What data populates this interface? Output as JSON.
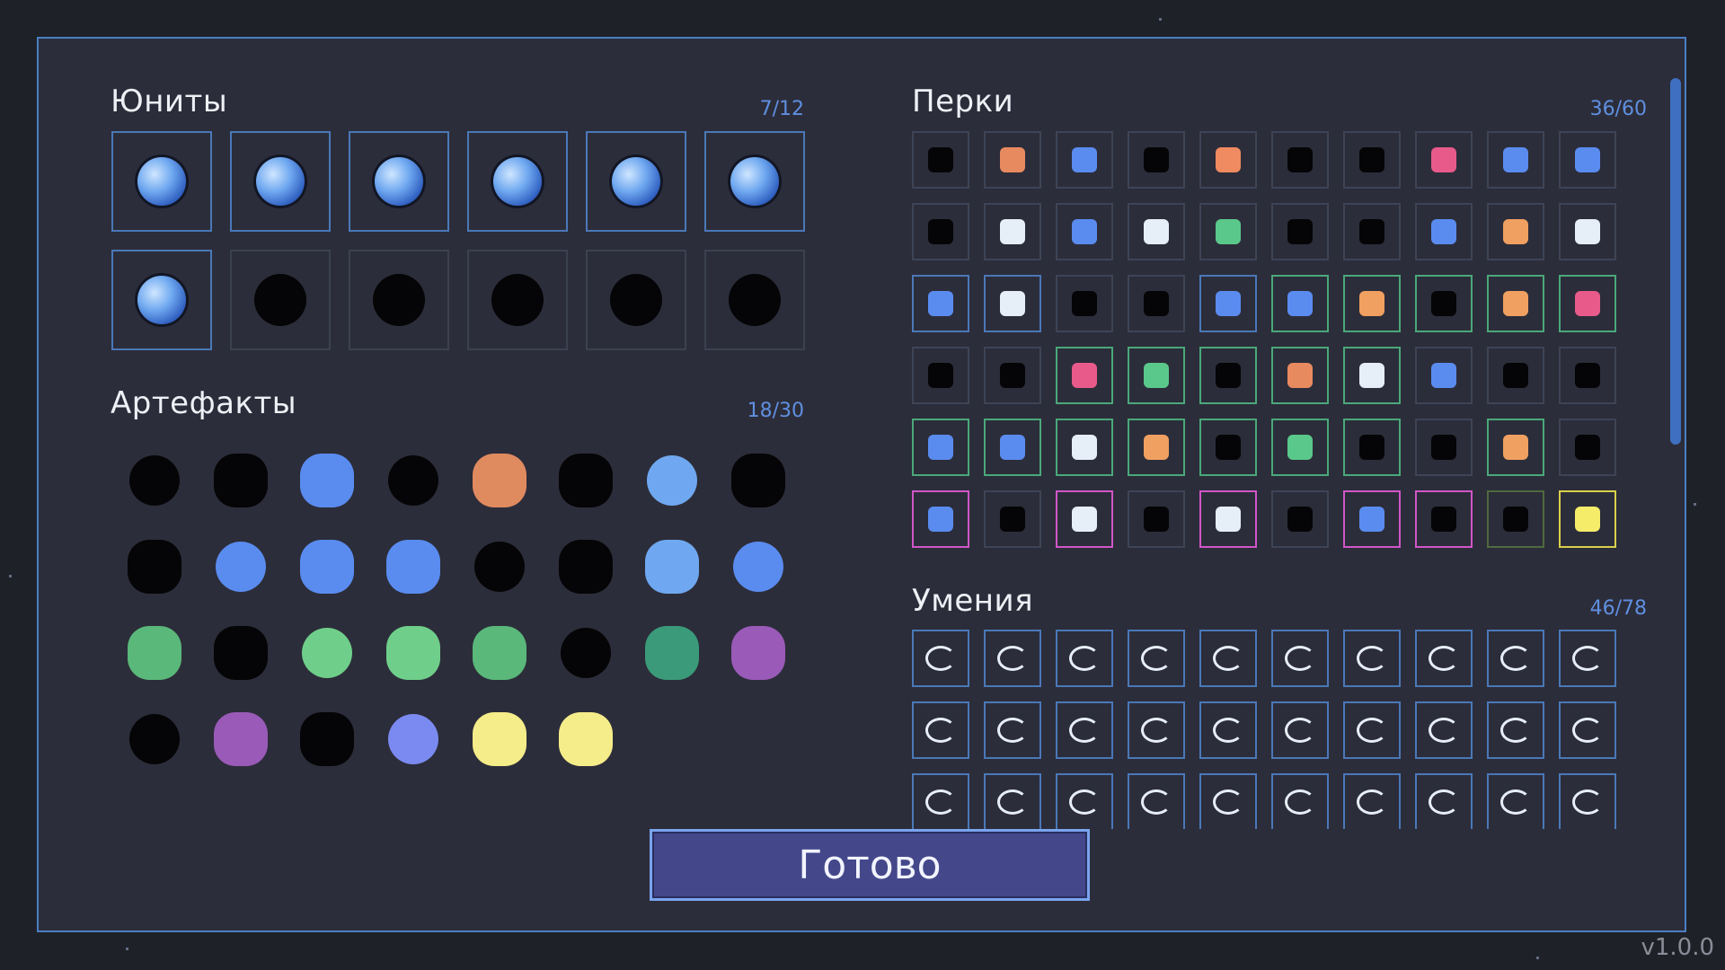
{
  "units": {
    "title": "Юниты",
    "counter": "7/12",
    "cells": [
      {
        "state": "unlocked"
      },
      {
        "state": "unlocked"
      },
      {
        "state": "unlocked"
      },
      {
        "state": "unlocked"
      },
      {
        "state": "unlocked"
      },
      {
        "state": "unlocked"
      },
      {
        "state": "unlocked"
      },
      {
        "state": "locked"
      },
      {
        "state": "locked"
      },
      {
        "state": "locked"
      },
      {
        "state": "locked"
      },
      {
        "state": "locked"
      }
    ]
  },
  "artifacts": {
    "title": "Артефакты",
    "counter": "18/30",
    "items": [
      {
        "color": "#050507"
      },
      {
        "color": "#050507"
      },
      {
        "color": "#5a8cf0"
      },
      {
        "color": "#050507"
      },
      {
        "color": "#e08a60"
      },
      {
        "color": "#050507"
      },
      {
        "color": "#6fa8f0"
      },
      {
        "color": "#050507"
      },
      {
        "color": "#050507"
      },
      {
        "color": "#5a8cf0"
      },
      {
        "color": "#5a8cf0"
      },
      {
        "color": "#5a8cf0"
      },
      {
        "color": "#050507"
      },
      {
        "color": "#050507"
      },
      {
        "color": "#6fa8f0"
      },
      {
        "color": "#5a8cf0"
      },
      {
        "color": "#5ab87a"
      },
      {
        "color": "#050507"
      },
      {
        "color": "#6fcf8a"
      },
      {
        "color": "#6fcf8a"
      },
      {
        "color": "#5ab87a"
      },
      {
        "color": "#050507"
      },
      {
        "color": "#3a9a7a"
      },
      {
        "color": "#9a5ab8"
      },
      {
        "color": "#050507"
      },
      {
        "color": "#9a5ab8"
      },
      {
        "color": "#050507"
      },
      {
        "color": "#7a8af0"
      },
      {
        "color": "#f5ec8a"
      },
      {
        "color": "#f5ec8a"
      }
    ]
  },
  "perks": {
    "title": "Перки",
    "counter": "36/60",
    "cells": [
      {
        "border": "dim",
        "color": "#050507"
      },
      {
        "border": "dim",
        "color": "#e88a60"
      },
      {
        "border": "dim",
        "color": "#5a8cf0"
      },
      {
        "border": "dim",
        "color": "#050507"
      },
      {
        "border": "dim",
        "color": "#f08a60"
      },
      {
        "border": "dim",
        "color": "#050507"
      },
      {
        "border": "dim",
        "color": "#050507"
      },
      {
        "border": "dim",
        "color": "#e85a8a"
      },
      {
        "border": "dim",
        "color": "#5a8cf0"
      },
      {
        "border": "dim",
        "color": "#5a8cf0"
      },
      {
        "border": "dim",
        "color": "#050507"
      },
      {
        "border": "dim",
        "color": "#e6eef8"
      },
      {
        "border": "dim",
        "color": "#5a8cf0"
      },
      {
        "border": "dim",
        "color": "#e6eef8"
      },
      {
        "border": "dim",
        "color": "#5ac88a"
      },
      {
        "border": "dim",
        "color": "#050507"
      },
      {
        "border": "dim",
        "color": "#050507"
      },
      {
        "border": "dim",
        "color": "#5a8cf0"
      },
      {
        "border": "dim",
        "color": "#f0a060"
      },
      {
        "border": "dim",
        "color": "#e6eef8"
      },
      {
        "border": "blue",
        "color": "#5a8cf0"
      },
      {
        "border": "blue",
        "color": "#e6eef8"
      },
      {
        "border": "dim",
        "color": "#050507"
      },
      {
        "border": "dim",
        "color": "#050507"
      },
      {
        "border": "blue",
        "color": "#5a8cf0"
      },
      {
        "border": "green",
        "color": "#5a8cf0"
      },
      {
        "border": "green",
        "color": "#f0a060"
      },
      {
        "border": "green",
        "color": "#050507"
      },
      {
        "border": "green",
        "color": "#f0a060"
      },
      {
        "border": "green",
        "color": "#e85a8a"
      },
      {
        "border": "dim",
        "color": "#050507"
      },
      {
        "border": "dim",
        "color": "#050507"
      },
      {
        "border": "green",
        "color": "#e85a8a"
      },
      {
        "border": "green",
        "color": "#5ac88a"
      },
      {
        "border": "green",
        "color": "#050507"
      },
      {
        "border": "green",
        "color": "#e88a60"
      },
      {
        "border": "green",
        "color": "#e6eef8"
      },
      {
        "border": "dim",
        "color": "#5a8cf0"
      },
      {
        "border": "dim",
        "color": "#050507"
      },
      {
        "border": "dim",
        "color": "#050507"
      },
      {
        "border": "green",
        "color": "#5a8cf0"
      },
      {
        "border": "green",
        "color": "#5a8cf0"
      },
      {
        "border": "green",
        "color": "#e6eef8"
      },
      {
        "border": "green",
        "color": "#f0a060"
      },
      {
        "border": "green",
        "color": "#050507"
      },
      {
        "border": "green",
        "color": "#5ac88a"
      },
      {
        "border": "green",
        "color": "#050507"
      },
      {
        "border": "dim",
        "color": "#050507"
      },
      {
        "border": "green",
        "color": "#f0a060"
      },
      {
        "border": "dim",
        "color": "#050507"
      },
      {
        "border": "pink",
        "color": "#5a8cf0"
      },
      {
        "border": "dim",
        "color": "#050507"
      },
      {
        "border": "pink",
        "color": "#e6eef8"
      },
      {
        "border": "dim",
        "color": "#050507"
      },
      {
        "border": "pink",
        "color": "#e6eef8"
      },
      {
        "border": "dim",
        "color": "#050507"
      },
      {
        "border": "pink",
        "color": "#5a8cf0"
      },
      {
        "border": "pink",
        "color": "#050507"
      },
      {
        "border": "darkgreen",
        "color": "#050507"
      },
      {
        "border": "yellow",
        "color": "#f5ec6a"
      }
    ]
  },
  "skills": {
    "title": "Умения",
    "counter": "46/78",
    "cells": [
      {
        "border": "blue"
      },
      {
        "border": "blue"
      },
      {
        "border": "blue"
      },
      {
        "border": "blue"
      },
      {
        "border": "blue"
      },
      {
        "border": "blue"
      },
      {
        "border": "blue"
      },
      {
        "border": "blue"
      },
      {
        "border": "blue"
      },
      {
        "border": "blue"
      },
      {
        "border": "blue"
      },
      {
        "border": "blue"
      },
      {
        "border": "blue"
      },
      {
        "border": "blue"
      },
      {
        "border": "blue"
      },
      {
        "border": "blue"
      },
      {
        "border": "blue"
      },
      {
        "border": "blue"
      },
      {
        "border": "blue"
      },
      {
        "border": "blue"
      },
      {
        "border": "blue"
      },
      {
        "border": "blue"
      },
      {
        "border": "blue"
      },
      {
        "border": "blue"
      },
      {
        "border": "blue"
      },
      {
        "border": "blue"
      },
      {
        "border": "blue"
      },
      {
        "border": "blue"
      },
      {
        "border": "blue"
      },
      {
        "border": "blue"
      }
    ]
  },
  "done_button": "Готово",
  "version": "v1.0.0"
}
